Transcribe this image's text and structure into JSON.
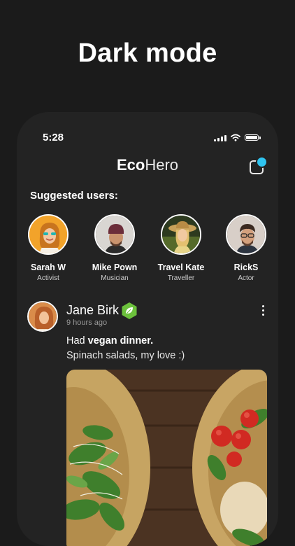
{
  "headline": "Dark mode",
  "status_bar": {
    "time": "5:28"
  },
  "app": {
    "title_bold": "Eco",
    "title_regular": "Hero"
  },
  "suggested": {
    "title": "Suggested users:",
    "users": [
      {
        "name": "Sarah W",
        "role": "Activist"
      },
      {
        "name": "Mike Pown",
        "role": "Musician"
      },
      {
        "name": "Travel Kate",
        "role": "Traveller"
      },
      {
        "name": "RickS",
        "role": "Actor"
      }
    ]
  },
  "post": {
    "author": "Jane Birk",
    "time": "9 hours ago",
    "line1_prefix": "Had ",
    "line1_bold": "vegan dinner.",
    "line2": "Spinach salads, my love :)"
  },
  "colors": {
    "accent_dot": "#2fc4f0",
    "badge_green": "#6cc13c",
    "background": "#1b1b1b",
    "card": "#232323"
  }
}
